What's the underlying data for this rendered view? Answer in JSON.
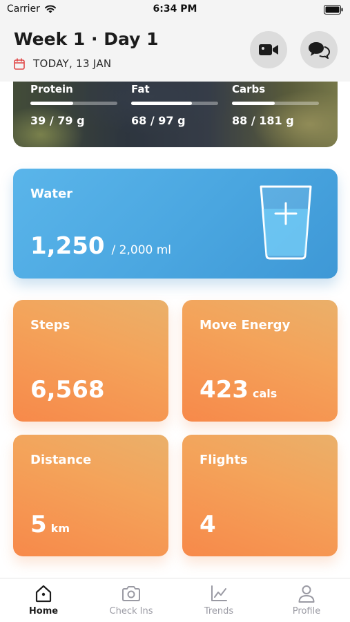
{
  "status_bar": {
    "carrier": "Carrier",
    "time": "6:34 PM"
  },
  "header": {
    "title": "Week 1 · Day 1",
    "date": "TODAY, 13 JAN",
    "accent_color": "#e04848"
  },
  "macros": [
    {
      "name": "Protein",
      "value_text": "39 / 79 g",
      "progress": 0.49
    },
    {
      "name": "Fat",
      "value_text": "68 / 97 g",
      "progress": 0.7
    },
    {
      "name": "Carbs",
      "value_text": "88 / 181 g",
      "progress": 0.49
    }
  ],
  "water": {
    "label": "Water",
    "value": "1,250",
    "goal": "/ 2,000 ml",
    "color": "#4aa6e0"
  },
  "stats": {
    "steps": {
      "label": "Steps",
      "value": "6,568",
      "unit": ""
    },
    "energy": {
      "label": "Move Energy",
      "value": "423",
      "unit": "cals"
    },
    "distance": {
      "label": "Distance",
      "value": "5",
      "unit": "km"
    },
    "flights": {
      "label": "Flights",
      "value": "4",
      "unit": ""
    },
    "color": "#f4a35a"
  },
  "tabs": [
    {
      "label": "Home",
      "icon": "home-icon",
      "active": true
    },
    {
      "label": "Check Ins",
      "icon": "camera-icon",
      "active": false
    },
    {
      "label": "Trends",
      "icon": "chart-icon",
      "active": false
    },
    {
      "label": "Profile",
      "icon": "person-icon",
      "active": false
    }
  ]
}
